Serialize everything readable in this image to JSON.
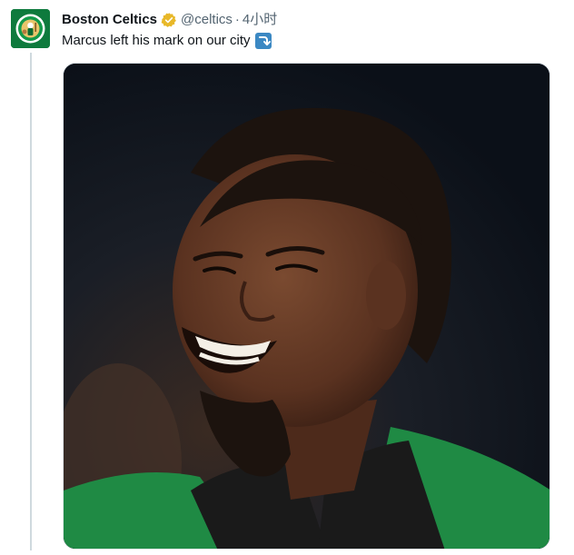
{
  "tweet": {
    "author_name": "Boston Celtics",
    "handle": "@celtics",
    "separator": "·",
    "timestamp": "4小时",
    "text": "Marcus left his mark on our city",
    "emoji": "right-arrow-curving-down-emoji",
    "verified_color": "#e8b829"
  },
  "avatar": {
    "icon": "celtics-logo-icon",
    "background": "#0e7a3d"
  },
  "media": {
    "subject": "photo-player-smiling"
  }
}
